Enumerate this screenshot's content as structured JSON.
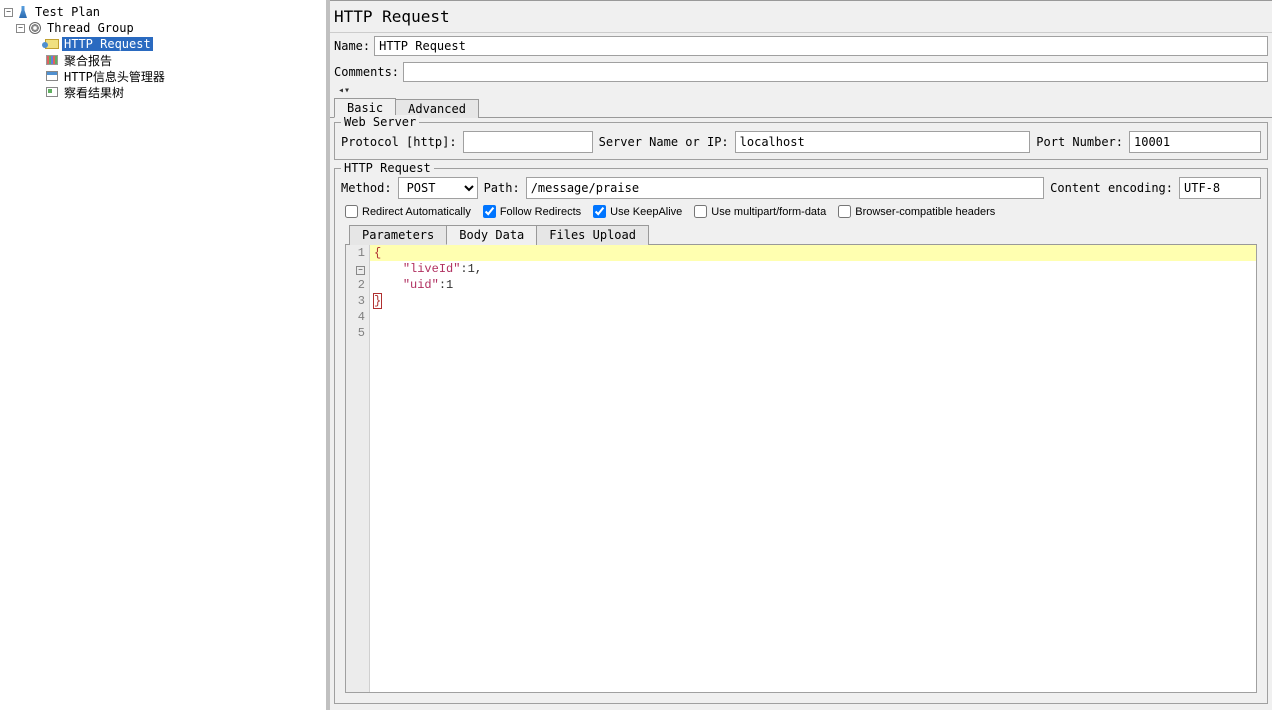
{
  "tree": {
    "root": "Test Plan",
    "group": "Thread Group",
    "items": [
      "HTTP Request",
      "聚合报告",
      "HTTP信息头管理器",
      "察看结果树"
    ]
  },
  "panel": {
    "title": "HTTP Request",
    "name_label": "Name:",
    "name_value": "HTTP Request",
    "comments_label": "Comments:",
    "comments_value": ""
  },
  "tabs": {
    "basic": "Basic",
    "advanced": "Advanced"
  },
  "webserver": {
    "legend": "Web Server",
    "protocol_label": "Protocol [http]:",
    "protocol_value": "",
    "server_label": "Server Name or IP:",
    "server_value": "localhost",
    "port_label": "Port Number:",
    "port_value": "10001"
  },
  "request": {
    "legend": "HTTP Request",
    "method_label": "Method:",
    "method_value": "POST",
    "path_label": "Path:",
    "path_value": "/message/praise",
    "enc_label": "Content encoding:",
    "enc_value": "UTF-8"
  },
  "checks": {
    "redirect_auto": "Redirect Automatically",
    "follow_redirects": "Follow Redirects",
    "keepalive": "Use KeepAlive",
    "multipart": "Use multipart/form-data",
    "browser_compat": "Browser-compatible headers"
  },
  "subtabs": {
    "params": "Parameters",
    "body": "Body Data",
    "files": "Files Upload"
  },
  "body_data": {
    "lines": [
      "{",
      "    \"liveId\":1,",
      "    \"uid\":1",
      "}",
      ""
    ]
  }
}
